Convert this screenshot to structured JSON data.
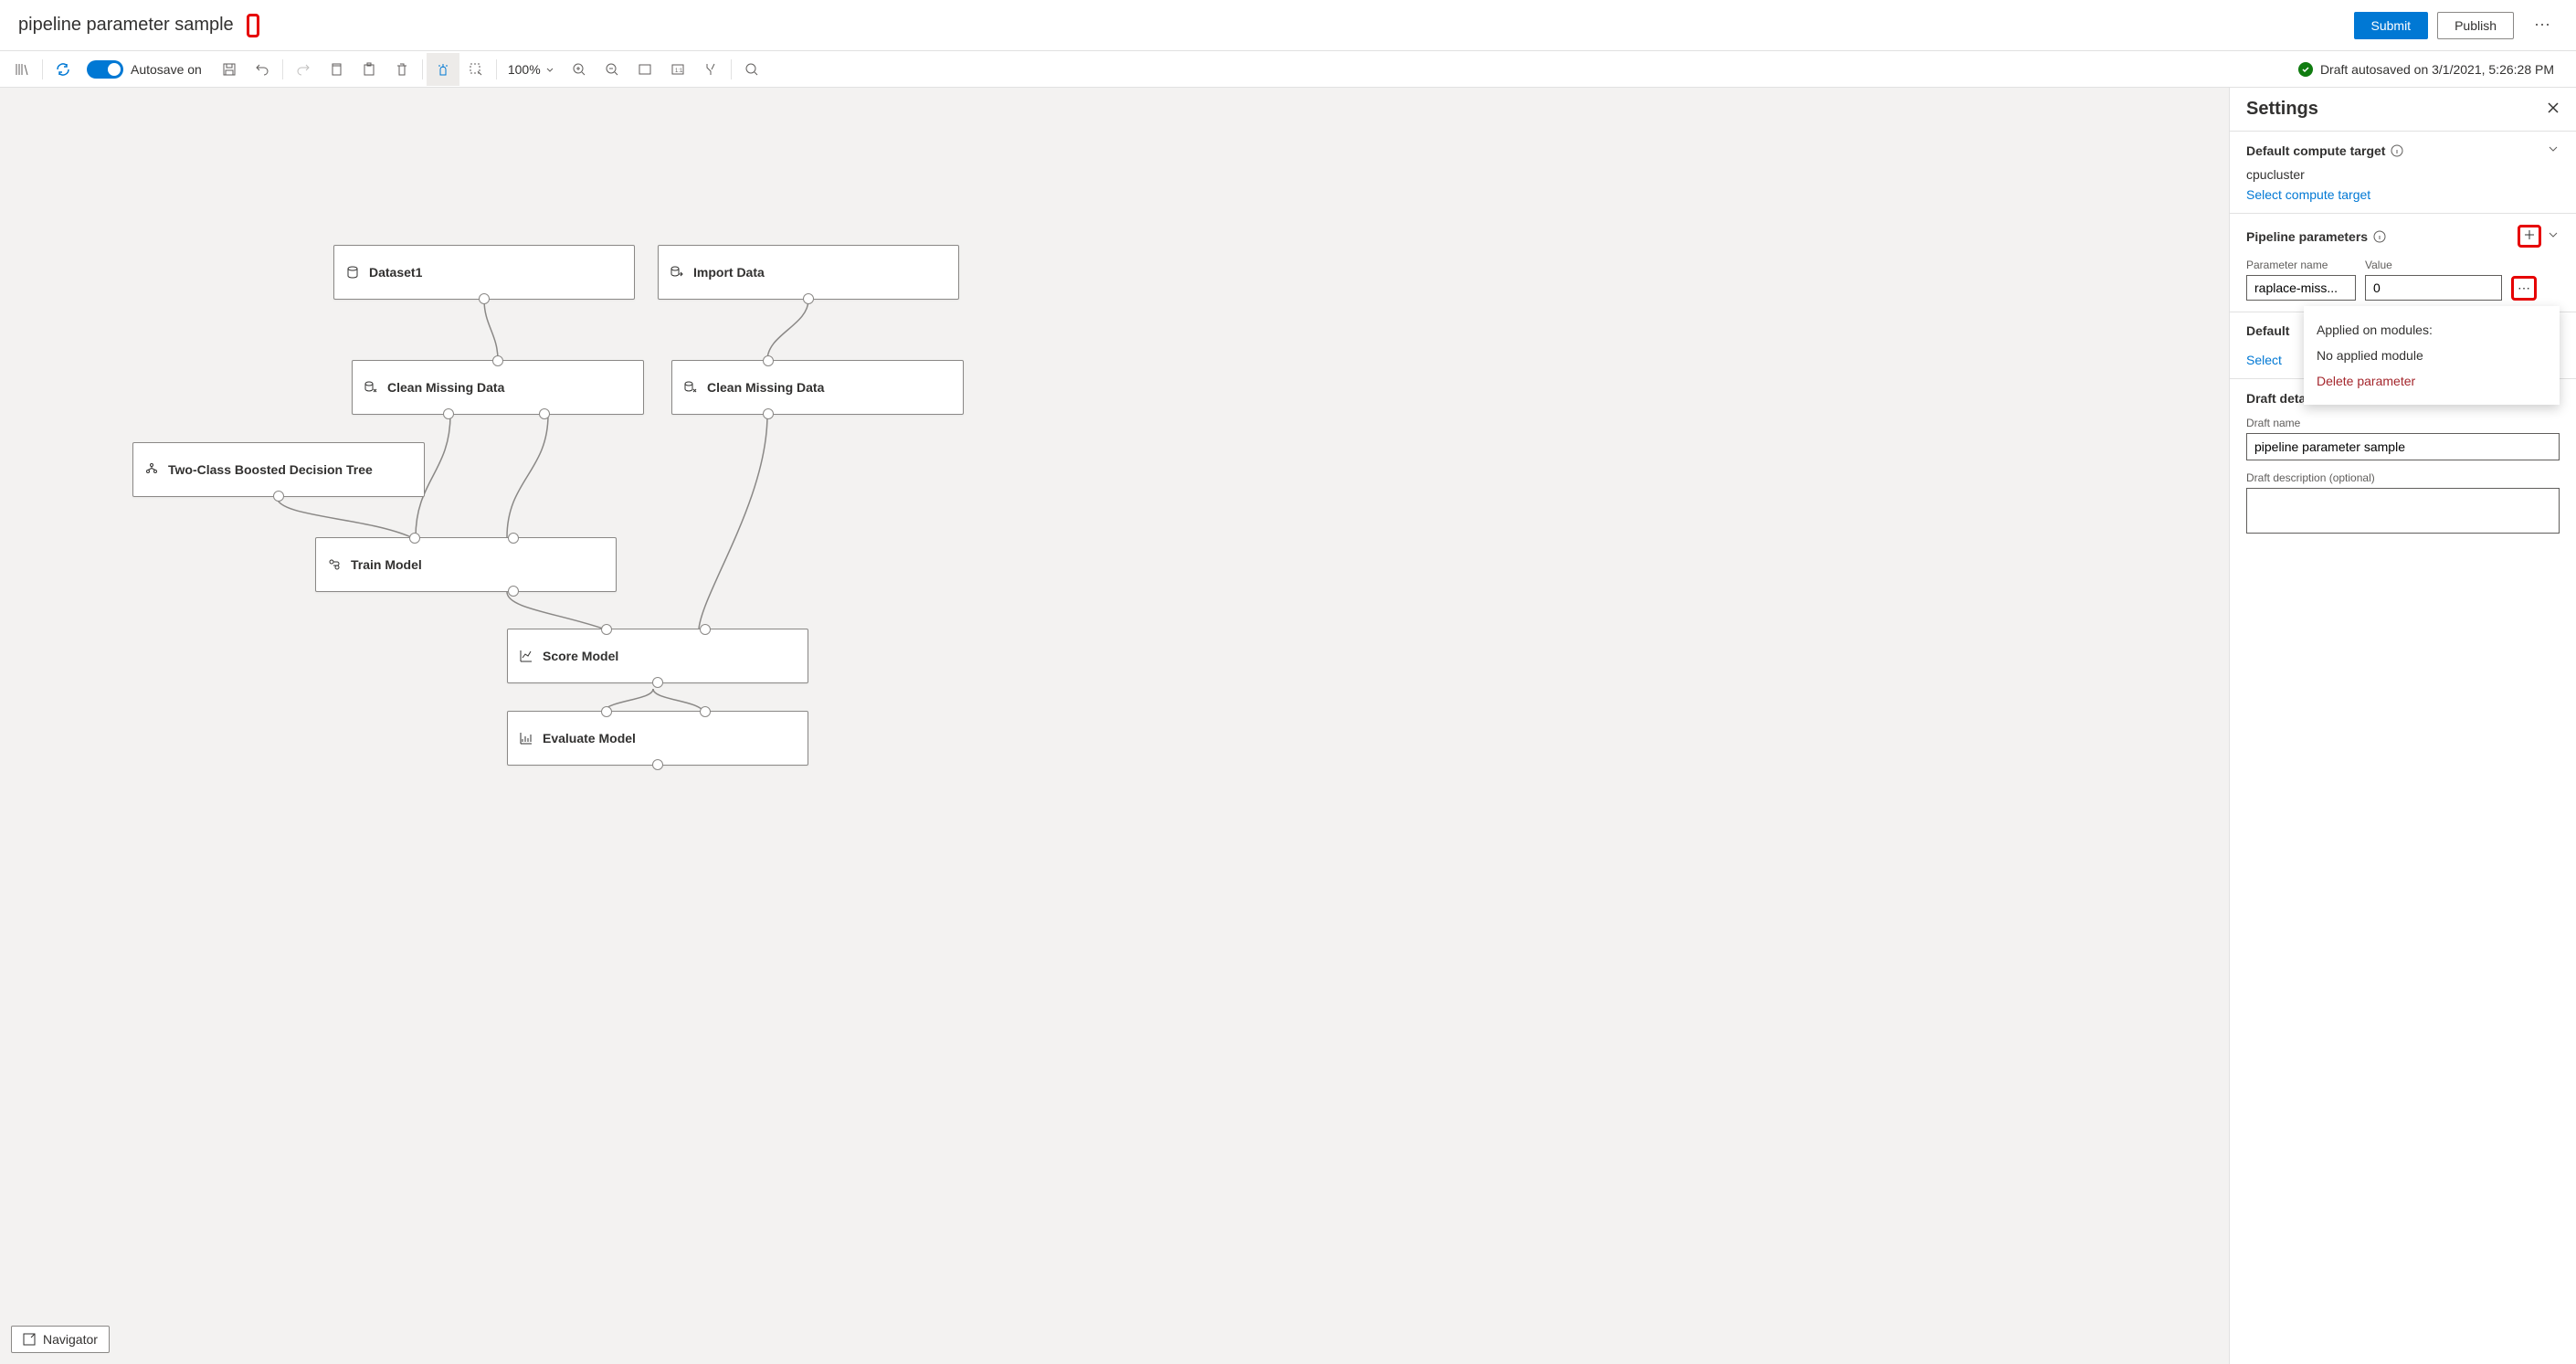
{
  "header": {
    "title": "pipeline parameter sample",
    "submit": "Submit",
    "publish": "Publish"
  },
  "toolbar": {
    "autosave": "Autosave on",
    "zoom": "100%",
    "status": "Draft autosaved on 3/1/2021, 5:26:28 PM"
  },
  "nodes": {
    "dataset1": "Dataset1",
    "importData": "Import Data",
    "clean1": "Clean Missing Data",
    "clean2": "Clean Missing Data",
    "tree": "Two-Class Boosted Decision Tree",
    "train": "Train Model",
    "score": "Score Model",
    "eval": "Evaluate Model"
  },
  "navigator": "Navigator",
  "panel": {
    "title": "Settings",
    "compute": {
      "title": "Default compute target",
      "value": "cpucluster",
      "link": "Select compute target"
    },
    "params": {
      "title": "Pipeline parameters",
      "nameLabel": "Parameter name",
      "valueLabel": "Value",
      "paramName": "raplace-miss...",
      "paramValue": "0",
      "popup": {
        "appliedLabel": "Applied on modules:",
        "appliedValue": "No applied module",
        "delete": "Delete parameter"
      }
    },
    "datastore": {
      "title": "Default",
      "link": "Select"
    },
    "draft": {
      "title": "Draft details",
      "nameLabel": "Draft name",
      "nameValue": "pipeline parameter sample",
      "descLabel": "Draft description (optional)"
    }
  }
}
